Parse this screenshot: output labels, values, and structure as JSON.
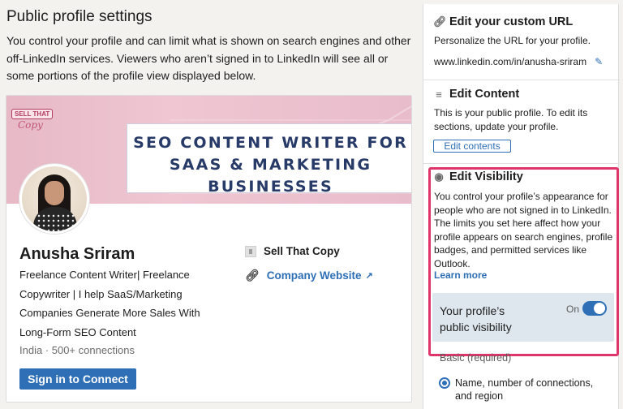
{
  "page": {
    "title": "Public profile settings",
    "intro": "You control your profile and can limit what is shown on search engines and other off-LinkedIn services. Viewers who aren’t signed in to LinkedIn will see all or some portions of the profile view displayed below."
  },
  "profile": {
    "banner": {
      "logo_line1": "SELL THAT",
      "logo_line2": "Copy",
      "headline_art": "SEO CONTENT WRITER FOR\nSAAS & MARKETING\nBUSINESSES"
    },
    "name": "Anusha Sriram",
    "headline": "Freelance Content Writer| Freelance Copywriter | I help SaaS/Marketing Companies Generate More Sales With Long-Form SEO Content",
    "location_connections": "India · 500+ connections",
    "connect_button": "Sign in to Connect",
    "company": "Sell That Copy",
    "website": "Company Website"
  },
  "sidebar": {
    "custom_url": {
      "title": "Edit your custom URL",
      "desc": "Personalize the URL for your profile.",
      "url": "www.linkedin.com/in/anusha-sriram"
    },
    "content": {
      "title": "Edit Content",
      "desc": "This is your public profile. To edit its sections, update your profile.",
      "button": "Edit contents"
    },
    "visibility": {
      "title": "Edit Visibility",
      "desc": "You control your profile’s appearance for people who are not signed in to LinkedIn. The limits you set here affect how your profile appears on search engines, profile badges, and permitted services like Outlook.",
      "learn_more": "Learn more",
      "toggle_label": "Your profile’s public visibility",
      "toggle_state": "On",
      "basic_label": "Basic (required)",
      "basic_option": "Name, number of connections, and region"
    }
  },
  "colors": {
    "accent": "#2e6fb6",
    "highlight": "#e0356b",
    "toggle_bg": "#dfe7ee"
  }
}
